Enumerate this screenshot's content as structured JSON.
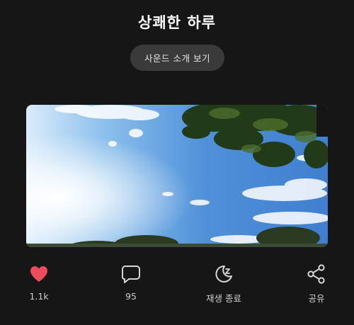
{
  "screen": {
    "title": "상쾌한 하루"
  },
  "sound_intro_button": {
    "label": "사운드 소개 보기"
  },
  "image": {
    "alt": "나무와 푸른 하늘"
  },
  "actions": [
    {
      "name": "like",
      "icon": "heart-icon",
      "label": "1.1k",
      "color": "#ee4b5d"
    },
    {
      "name": "comment",
      "icon": "comment-icon",
      "label": "95"
    },
    {
      "name": "sleep-timer",
      "icon": "moon-zzz-icon",
      "label": "재생 종료"
    },
    {
      "name": "share",
      "icon": "share-icon",
      "label": "공유"
    }
  ]
}
